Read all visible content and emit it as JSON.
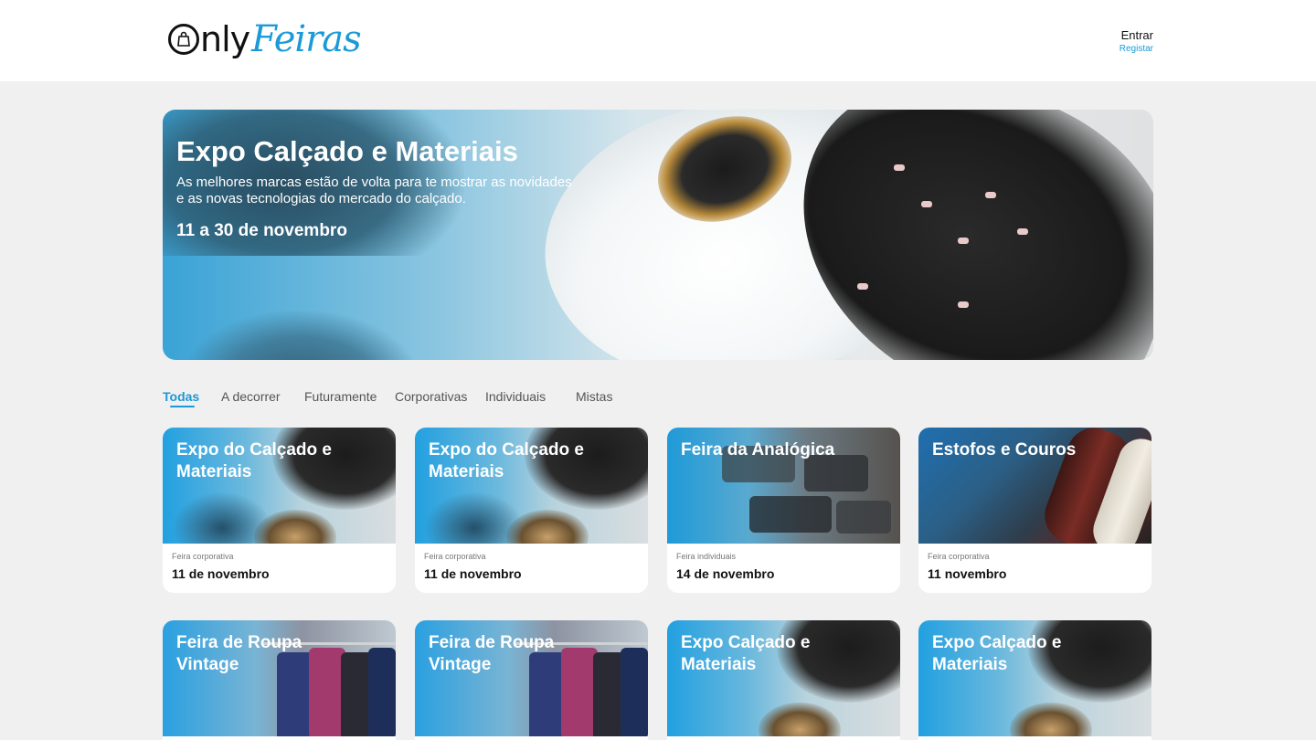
{
  "header": {
    "logo_prefix": "nly",
    "logo_suffix": "Feiras",
    "login_label": "Entrar",
    "register_label": "Registar"
  },
  "hero": {
    "title": "Expo Calçado e Materiais",
    "description": "As melhores marcas estão de volta para te mostrar as novidades e as novas tecnologias do mercado do calçado.",
    "date": "11 a 30 de novembro"
  },
  "tabs": [
    {
      "label": "Todas",
      "active": true
    },
    {
      "label": "A decorrer",
      "active": false
    },
    {
      "label": "Futuramente",
      "active": false
    },
    {
      "label": "Corporativas",
      "active": false
    },
    {
      "label": "Individuais",
      "active": false
    },
    {
      "label": "Mistas",
      "active": false
    }
  ],
  "cards": [
    {
      "title": "Expo do Calçado e Materiais",
      "type": "Feira corporativa",
      "date": "11 de novembro",
      "image": "shoes"
    },
    {
      "title": "Expo do Calçado e Materiais",
      "type": "Feira corporativa",
      "date": "11 de novembro",
      "image": "shoes"
    },
    {
      "title": "Feira da Analógica",
      "type": "Feira individuais",
      "date": "14 de novembro",
      "image": "camera"
    },
    {
      "title": "Estofos e Couros",
      "type": "Feira corporativa",
      "date": "11 novembro",
      "image": "leather"
    },
    {
      "title": "Feira de Roupa Vintage",
      "image": "clothes"
    },
    {
      "title": "Feira de Roupa Vintage",
      "image": "clothes"
    },
    {
      "title": "Expo Calçado e Materiais",
      "image": "shoes"
    },
    {
      "title": "Expo Calçado e Materiais",
      "image": "shoes"
    }
  ],
  "colors": {
    "accent": "#1a9ad6",
    "background": "#f0f0f0"
  }
}
